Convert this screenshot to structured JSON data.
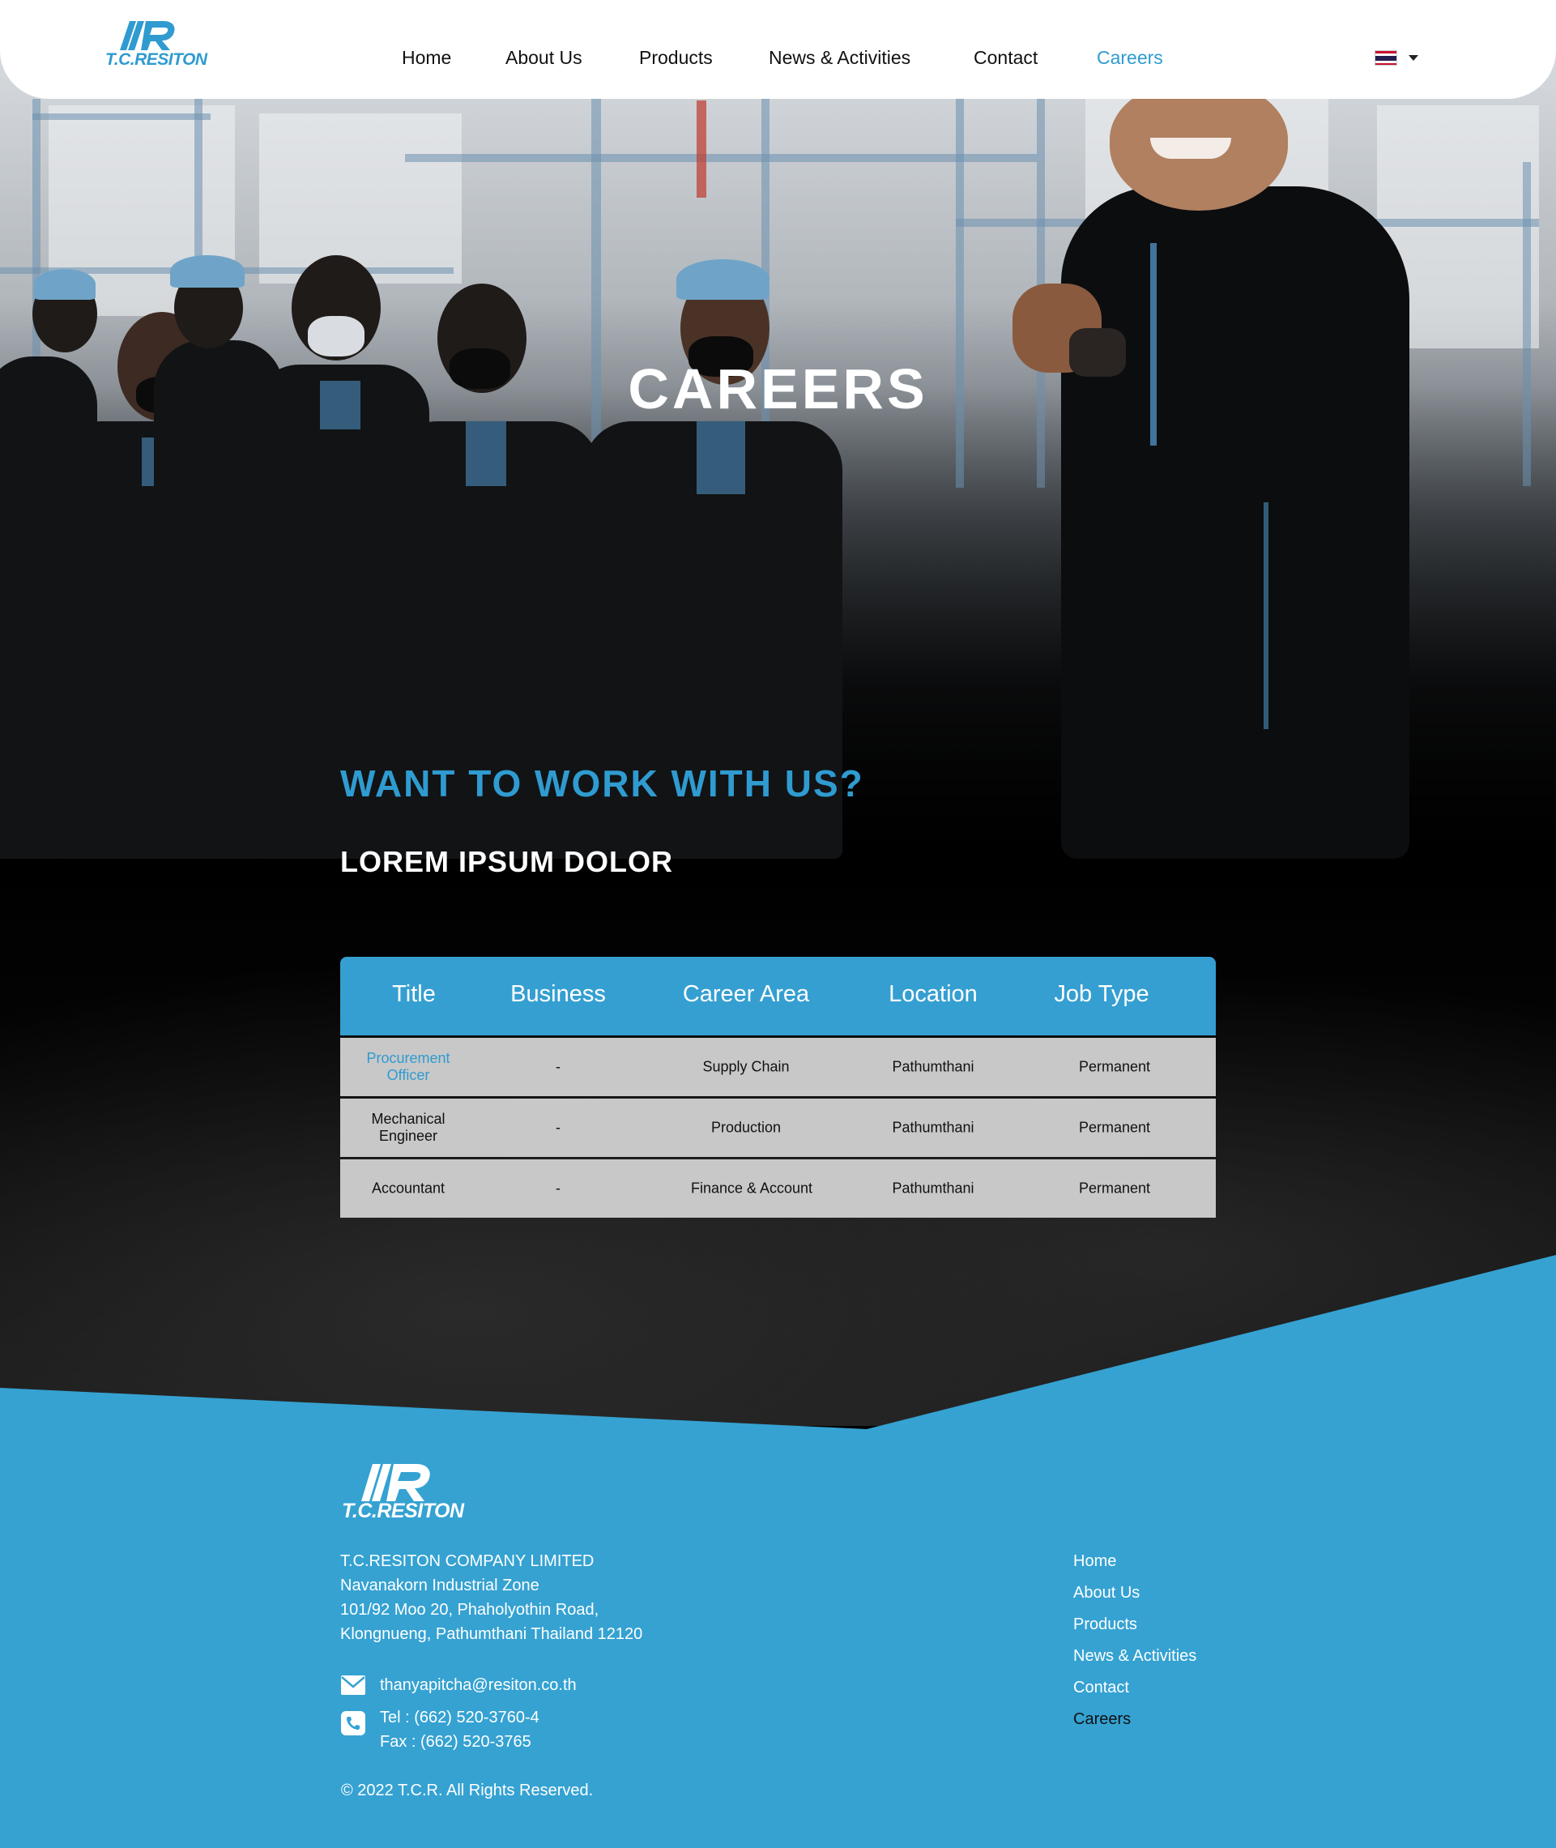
{
  "header": {
    "logo_text": "T.C.RESITON",
    "nav": [
      {
        "label": "Home"
      },
      {
        "label": "About Us"
      },
      {
        "label": "Products"
      },
      {
        "label": "News & Activities"
      },
      {
        "label": "Contact"
      },
      {
        "label": "Careers"
      }
    ],
    "language": {
      "flag": "thai-flag-icon"
    }
  },
  "hero": {
    "title": "CAREERS"
  },
  "intro": {
    "heading": "WANT TO WORK WITH US?",
    "subheading": "LOREM IPSUM DOLOR"
  },
  "jobs_table": {
    "columns": [
      "Title",
      "Business",
      "Career Area",
      "Location",
      "Job Type"
    ],
    "rows": [
      {
        "title": "Procurement Officer",
        "business": "-",
        "career_area": "Supply Chain",
        "location": "Pathumthani",
        "job_type": "Permanent"
      },
      {
        "title": "Mechanical Engineer",
        "business": "-",
        "career_area": "Production",
        "location": "Pathumthani",
        "job_type": "Permanent"
      },
      {
        "title": "Accountant",
        "business": "-",
        "career_area": "Finance & Account",
        "location": "Pathumthani",
        "job_type": "Permanent"
      }
    ]
  },
  "footer": {
    "logo_text": "T.C.RESITON",
    "company_name": "T.C.RESITON COMPANY LIMITED",
    "address": [
      "Navanakorn Industrial Zone",
      "101/92 Moo 20, Phaholyothin Road,",
      "Klongnueng, Pathumthani Thailand 12120"
    ],
    "email": "thanyapitcha@resiton.co.th",
    "tel": "Tel  : (662) 520-3760-4",
    "fax": "Fax : (662) 520-3765",
    "copyright": "© 2022 T.C.R. All Rights Reserved.",
    "links": [
      {
        "label": "Home"
      },
      {
        "label": "About Us"
      },
      {
        "label": "Products"
      },
      {
        "label": "News & Activities"
      },
      {
        "label": "Contact"
      },
      {
        "label": "Careers"
      }
    ]
  },
  "colors": {
    "accent": "#2f9bd0",
    "table_header": "#359fd1",
    "row_bg": "#c8c8c8",
    "footer_bg": "#35a2d2"
  }
}
